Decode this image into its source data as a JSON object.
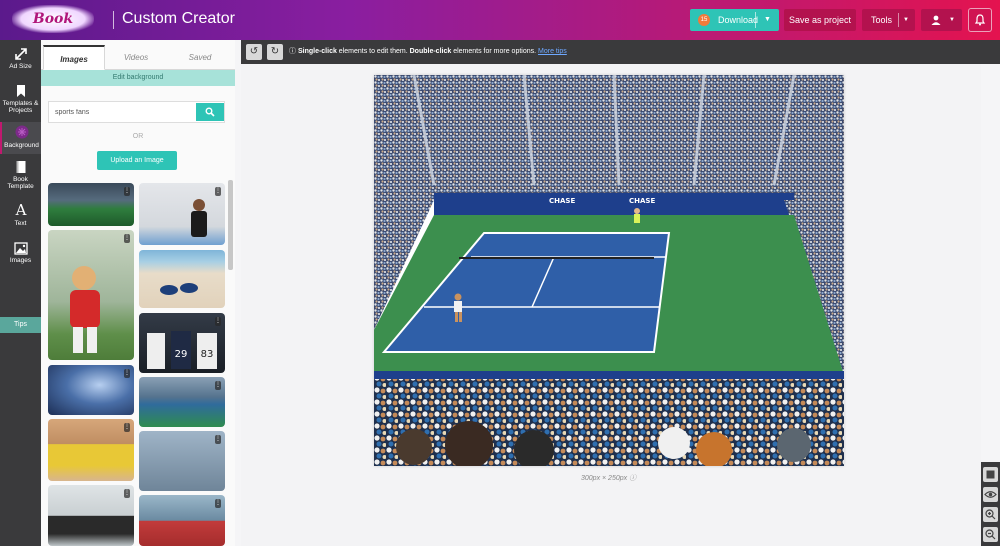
{
  "header": {
    "logo_text": "Book Brush",
    "app_title": "Custom Creator",
    "download": {
      "badge": "15",
      "label": "Download"
    },
    "save_label": "Save as project",
    "tools_label": "Tools"
  },
  "sidebar": {
    "items": [
      {
        "label": "Ad Size",
        "icon": "resize-icon"
      },
      {
        "label": "Templates & Projects",
        "icon": "bookmark-icon"
      },
      {
        "label": "Background",
        "icon": "background-icon"
      },
      {
        "label": "Book Template",
        "icon": "book-icon"
      },
      {
        "label": "Text",
        "icon": "text-icon"
      },
      {
        "label": "Images",
        "icon": "image-icon"
      }
    ],
    "tips_label": "Tips"
  },
  "panel": {
    "tabs": [
      "Images",
      "Videos",
      "Saved"
    ],
    "edit_background": "Edit background",
    "search": {
      "value": "sports fans",
      "placeholder": ""
    },
    "or_label": "OR",
    "upload_label": "Upload an Image"
  },
  "toolbar": {
    "hint_part1": "Single-click",
    "hint_part2": " elements to edit them. ",
    "hint_part3": "Double-click",
    "hint_part4": " elements for more options. ",
    "more_link": "More tips"
  },
  "canvas": {
    "dimensions_label": "300px × 250px"
  },
  "colors": {
    "accent_teal": "#2ec4b6",
    "header_start": "#5b1a8c",
    "header_end": "#e4134f",
    "button_red": "#b3124e",
    "court_blue": "#2f5fa8",
    "court_green": "#3c8f4e"
  }
}
